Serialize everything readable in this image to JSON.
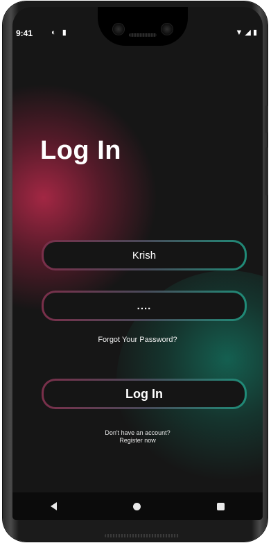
{
  "status_bar": {
    "time": "9:41",
    "left_icons": [
      "cast-icon",
      "sd-card-icon"
    ],
    "right_icons": [
      "wifi-icon",
      "signal-icon",
      "battery-icon"
    ]
  },
  "login": {
    "title": "Log In",
    "username_value": "Krish",
    "password_value": "....",
    "forgot_label": "Forgot Your Password?",
    "submit_label": "Log In",
    "no_account_text": "Don't have an account?",
    "register_label": "Register now"
  },
  "navbar": {
    "items": [
      "back-icon",
      "home-icon",
      "recents-icon"
    ]
  },
  "colors": {
    "background": "#161616",
    "red_glow": "#aa2846",
    "teal_glow": "#14786a",
    "border_left": "#7a2f4a",
    "border_right": "#1f8c78"
  }
}
